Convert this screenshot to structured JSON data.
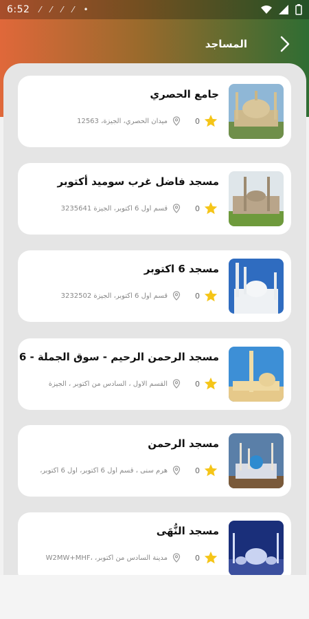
{
  "status_bar": {
    "time": "6:52"
  },
  "app_bar": {
    "title": "المساجد",
    "back_icon": "chevron-right-icon"
  },
  "mosques": [
    {
      "name": "جامع الحصري",
      "rating": "0",
      "address": "ميدان الحصري، الجيزة، 12563",
      "thumb": "dome"
    },
    {
      "name": "مسجد فاضل غرب سوميد أكتوبر",
      "rating": "0",
      "address": "قسم أول 6 أكتوبر، الجيزة 3235641",
      "thumb": "minarets-green"
    },
    {
      "name": "مسجد 6 اكتوبر",
      "rating": "0",
      "address": "قسم أول 6 أكتوبر، الجيزة 3232502",
      "thumb": "white-mosque"
    },
    {
      "name": "مسجد الرحمن الرحيم - سوق الجملة - 6",
      "rating": "0",
      "address": "القسم الاول ، السادس من اكتوبر ، الجيزة",
      "thumb": "tall-minaret"
    },
    {
      "name": "مسجد الرحمن",
      "rating": "0",
      "address": "هرم سنى ، قسم أول 6 أكتوبر، اول 6 أكتوبر،",
      "thumb": "kul-sharif"
    },
    {
      "name": "مسجد النُّهَى",
      "rating": "0",
      "address": "مدينة السادس من أكتوبر، ،W2MW+MHF",
      "thumb": "night-mosque"
    }
  ],
  "colors": {
    "star": "#f5c518",
    "accent_left": "#e0683a",
    "accent_right": "#2f6d33"
  }
}
